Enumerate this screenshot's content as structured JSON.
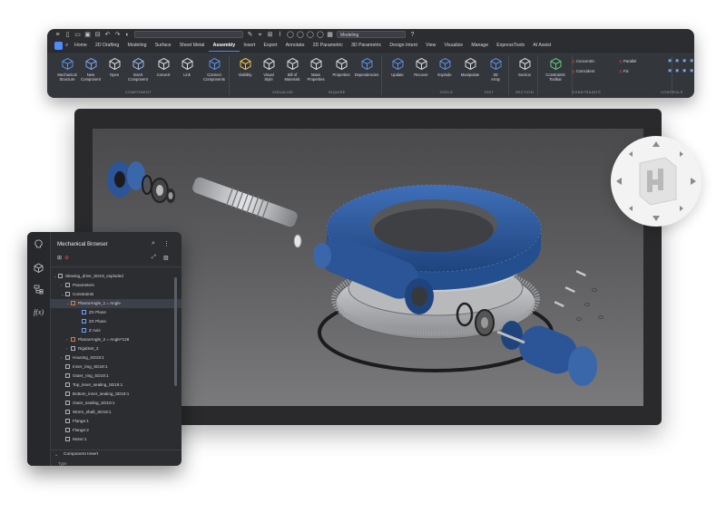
{
  "quick_access": {
    "doc_combo": "",
    "workspace": "Modeling"
  },
  "tabs": [
    "Home",
    "2D Drafting",
    "Modeling",
    "Surface",
    "Sheet Metal",
    "Assembly",
    "Insert",
    "Export",
    "Annotate",
    "2D Parametric",
    "3D Parametric",
    "Design Intent",
    "View",
    "Visualize",
    "Manage",
    "ExpressTools",
    "AI Assist"
  ],
  "active_tab": "Assembly",
  "ribbon": {
    "tools": [
      {
        "label": "Mechanical\nStructure"
      },
      {
        "label": "New\nComponent"
      },
      {
        "label": "Open"
      },
      {
        "label": "Insert\nComponent"
      },
      {
        "label": "Convert"
      },
      {
        "label": "Link"
      },
      {
        "label": "Connect\nComponents"
      },
      {
        "label": "Visibility"
      },
      {
        "label": "Visual\nStyle"
      },
      {
        "label": "Bill of\nMaterials"
      },
      {
        "label": "Mass\nProperties"
      },
      {
        "label": "Properties"
      },
      {
        "label": "Dependencies"
      },
      {
        "label": "Update"
      },
      {
        "label": "Recover"
      },
      {
        "label": "Explode"
      },
      {
        "label": "Manipulate"
      },
      {
        "label": "3D\nArray"
      },
      {
        "label": "Section"
      },
      {
        "label": "Constraints\nToolbar"
      }
    ],
    "constraints": [
      "Concentric",
      "Parallel",
      "Coincident",
      "Fix"
    ],
    "groups": [
      "COMPONENT",
      "VISUALIZE",
      "INQUIRE",
      "TOOLS",
      "EDIT",
      "SECTION",
      "CONSTRAINTS",
      "CONTROLS"
    ]
  },
  "browser": {
    "title": "Mechanical Browser",
    "items": [
      {
        "label": "Slewing_drive_SD19_exploded"
      },
      {
        "label": "Parameters"
      },
      {
        "label": "Constraints"
      },
      {
        "label": "PlanarAngle_1 = Angle"
      },
      {
        "label": "ZX Plane"
      },
      {
        "label": "ZX Plane"
      },
      {
        "label": "Z Axis"
      },
      {
        "label": "PlanarAngle_2 = Angle*128"
      },
      {
        "label": "RigidSet_3"
      },
      {
        "label": "Housing_SD19:1"
      },
      {
        "label": "Inner_ring_SD19:1"
      },
      {
        "label": "Outer_ring_SD19:1"
      },
      {
        "label": "Top_inner_sealing_SD19:1"
      },
      {
        "label": "Bottom_inner_sealing_SD19:1"
      },
      {
        "label": "Outer_sealing_SD19:1"
      },
      {
        "label": "Worm_shaft_SD19:1"
      },
      {
        "label": "Flange:1"
      },
      {
        "label": "Flange:2"
      },
      {
        "label": "Motor:1"
      }
    ],
    "section": "Component Insert",
    "section_sub": "Type"
  },
  "colors": {
    "ribbon_bg": "#2b2d31",
    "accent": "#4f8cff",
    "part_blue": "#2d5b9e",
    "viewport_top": "#4a4a4c"
  }
}
